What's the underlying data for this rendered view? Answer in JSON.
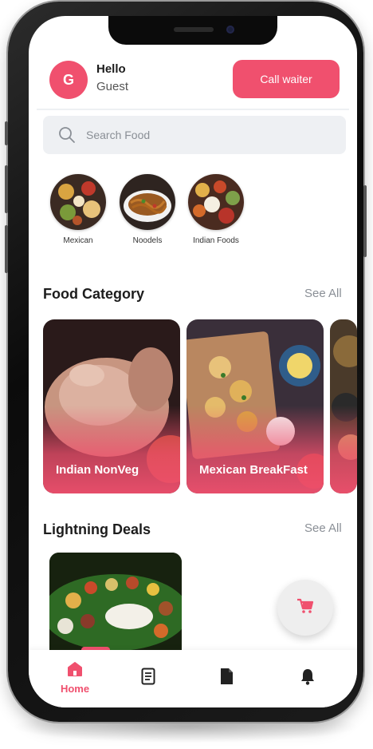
{
  "header": {
    "avatar_initial": "G",
    "greeting": "Hello",
    "username": "Guest",
    "call_waiter_label": "Call waiter"
  },
  "search": {
    "placeholder": "Search Food",
    "value": ""
  },
  "quick_categories": [
    {
      "label": "Mexican"
    },
    {
      "label": "Noodels"
    },
    {
      "label": "Indian Foods"
    }
  ],
  "food_category": {
    "title": "Food Category",
    "see_all": "See All",
    "cards": [
      {
        "label": "Indian NonVeg"
      },
      {
        "label": "Mexican BreakFast"
      }
    ]
  },
  "lightning_deals": {
    "title": "Lightning Deals",
    "see_all": "See All"
  },
  "bottom_nav": {
    "items": [
      {
        "label": "Home",
        "icon": "home-icon",
        "active": true
      },
      {
        "label": "",
        "icon": "orders-icon",
        "active": false
      },
      {
        "label": "",
        "icon": "document-icon",
        "active": false
      },
      {
        "label": "",
        "icon": "bell-icon",
        "active": false
      }
    ]
  },
  "colors": {
    "accent": "#f0506e",
    "search_bg": "#eef0f3",
    "text_primary": "#1d1d1d",
    "text_muted": "#8a8f96"
  }
}
